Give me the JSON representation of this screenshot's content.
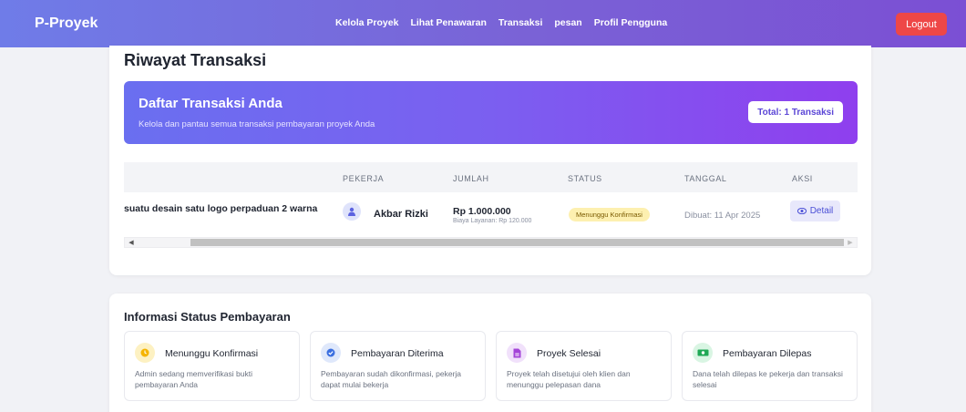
{
  "app": {
    "brand": "P-Proyek"
  },
  "nav": {
    "items": [
      "Kelola Proyek",
      "Lihat Penawaran",
      "Transaksi",
      "pesan",
      "Profil Pengguna"
    ],
    "logout": "Logout"
  },
  "page": {
    "title": "Riwayat Transaksi"
  },
  "banner": {
    "title": "Daftar Transaksi Anda",
    "subtitle": "Kelola dan pantau semua transaksi pembayaran proyek Anda",
    "total": "Total: 1 Transaksi"
  },
  "table": {
    "headers": [
      "PEKERJA",
      "JUMLAH",
      "STATUS",
      "TANGGAL",
      "AKSI"
    ],
    "rows": [
      {
        "project": "suatu desain satu logo perpaduan 2 warna",
        "worker": "Akbar Rizki",
        "amount": "Rp 1.000.000",
        "fee": "Biaya Layanan: Rp 120.000",
        "status": "Menunggu Konfirmasi",
        "date": "Dibuat: 11 Apr 2025",
        "action": "Detail"
      }
    ]
  },
  "info": {
    "title": "Informasi Status Pembayaran",
    "cards": [
      {
        "title": "Menunggu Konfirmasi",
        "desc": "Admin sedang memverifikasi bukti pembayaran Anda",
        "icon": "clock-icon",
        "color": "#f5b400"
      },
      {
        "title": "Pembayaran Diterima",
        "desc": "Pembayaran sudah dikonfirmasi, pekerja dapat mulai bekerja",
        "icon": "check-circle-icon",
        "color": "#3b6fe0"
      },
      {
        "title": "Proyek Selesai",
        "desc": "Proyek telah disetujui oleh klien dan menunggu pelepasan dana",
        "icon": "document-icon",
        "color": "#a445d8"
      },
      {
        "title": "Pembayaran Dilepas",
        "desc": "Dana telah dilepas ke pekerja dan transaksi selesai",
        "icon": "money-icon",
        "color": "#1fa855"
      }
    ]
  },
  "colors": {
    "accent": "#7b5ff0",
    "logout": "#ee4747"
  }
}
